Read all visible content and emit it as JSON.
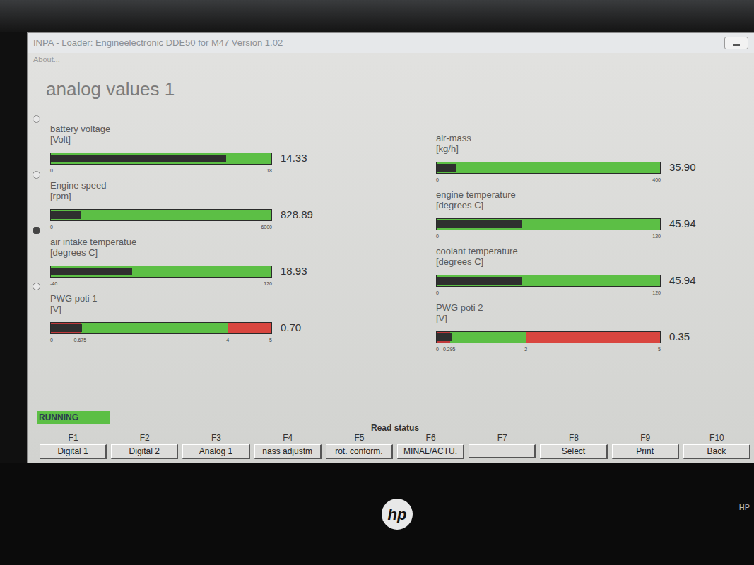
{
  "window": {
    "title": "INPA - Loader: Engineelectronic DDE50 for M47 Version 1.02",
    "menu": [
      "About..."
    ]
  },
  "heading": "analog values 1",
  "markers": [
    {
      "selected": false
    },
    {
      "selected": false
    },
    {
      "selected": true
    },
    {
      "selected": false
    }
  ],
  "left_gauges": [
    {
      "label": "battery voltage",
      "unit": "[Volt]",
      "ticks": [
        "0",
        "18"
      ],
      "zones": [
        "#5cbf45"
      ],
      "level": 0.796,
      "reading": "14.33"
    },
    {
      "label": "Engine speed",
      "unit": "[rpm]",
      "ticks": [
        "0",
        "6000"
      ],
      "zones": [
        "#5cbf45"
      ],
      "level": 0.138,
      "reading": "828.89"
    },
    {
      "label": "air intake temperatue",
      "unit": "[degrees C]",
      "ticks": [
        "-40",
        "120"
      ],
      "zones": [
        "#5cbf45"
      ],
      "level": 0.368,
      "reading": "18.93"
    },
    {
      "label": "PWG poti 1",
      "unit": "[V]",
      "ticks": [
        "0",
        "0.675",
        "4",
        "5"
      ],
      "zones": [
        "#c0393b",
        "#5cbf45",
        "#d9463f"
      ],
      "level": 0.14,
      "reading": "0.70"
    }
  ],
  "right_gauges": [
    {
      "label": "air-mass",
      "unit": "[kg/h]",
      "ticks": [
        "0",
        "400"
      ],
      "zones": [
        "#5cbf45"
      ],
      "level": 0.09,
      "reading": "35.90"
    },
    {
      "label": "engine temperature",
      "unit": "[degrees C]",
      "ticks": [
        "0",
        "120"
      ],
      "zones": [
        "#5cbf45"
      ],
      "level": 0.383,
      "reading": "45.94"
    },
    {
      "label": "coolant temperature",
      "unit": "[degrees C]",
      "ticks": [
        "0",
        "120"
      ],
      "zones": [
        "#5cbf45"
      ],
      "level": 0.383,
      "reading": "45.94"
    },
    {
      "label": "PWG poti 2",
      "unit": "[V]",
      "ticks": [
        "0",
        "0.295",
        "2",
        "5"
      ],
      "zones": [
        "#c0393b",
        "#5cbf45",
        "#d9463f"
      ],
      "level": 0.07,
      "reading": "0.35"
    }
  ],
  "status": "RUNNING",
  "group_label": "Read status",
  "function_keys": [
    {
      "key": "F1",
      "label": "Digital 1"
    },
    {
      "key": "F2",
      "label": "Digital 2"
    },
    {
      "key": "F3",
      "label": "Analog 1"
    },
    {
      "key": "F4",
      "label": "nass adjustm"
    },
    {
      "key": "F5",
      "label": "rot. conform."
    },
    {
      "key": "F6",
      "label": "MINAL/ACTU."
    },
    {
      "key": "F7",
      "label": ""
    },
    {
      "key": "F8",
      "label": "Select"
    },
    {
      "key": "F9",
      "label": "Print"
    },
    {
      "key": "F10",
      "label": "Back"
    }
  ],
  "bezel": {
    "logo": "hp",
    "brand_text": "HP"
  }
}
